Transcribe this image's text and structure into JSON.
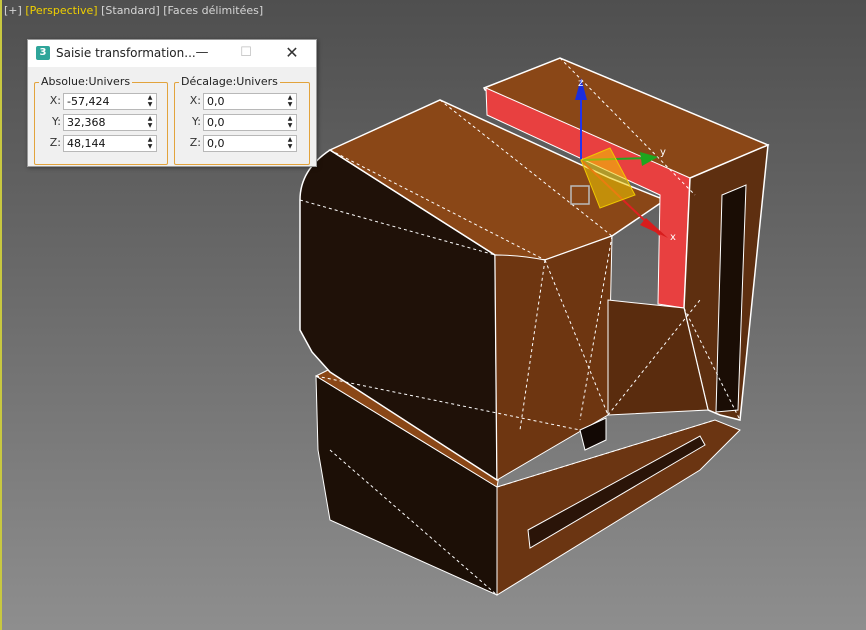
{
  "viewport": {
    "labels": [
      {
        "text": "[+]",
        "active": false
      },
      {
        "text": "[Perspective]",
        "active": true
      },
      {
        "text": "[Standard]",
        "active": false
      },
      {
        "text": "[Faces délimitées]",
        "active": false
      }
    ],
    "gizmo": {
      "x_label": "x",
      "y_label": "y",
      "z_label": "z"
    }
  },
  "dialog": {
    "title": "Saisie transformation...",
    "app_icon": "3",
    "minimize_icon": "minimize-icon",
    "maximize_icon": "maximize-icon",
    "close_icon": "close-icon",
    "absolute": {
      "title": "Absolue:Univers",
      "x_label": "X:",
      "x_value": "-57,424",
      "y_label": "Y:",
      "y_value": "32,368",
      "z_label": "Z:",
      "z_value": "48,144"
    },
    "offset": {
      "title": "Décalage:Univers",
      "x_label": "X:",
      "x_value": "0,0",
      "y_label": "Y:",
      "y_value": "0,0",
      "z_label": "Z:",
      "z_value": "0,0"
    }
  },
  "colors": {
    "object": "#8a4717",
    "selected_face": "#e84040",
    "group_border": "#e2a33c",
    "active_viewport_label": "#f0d000"
  }
}
